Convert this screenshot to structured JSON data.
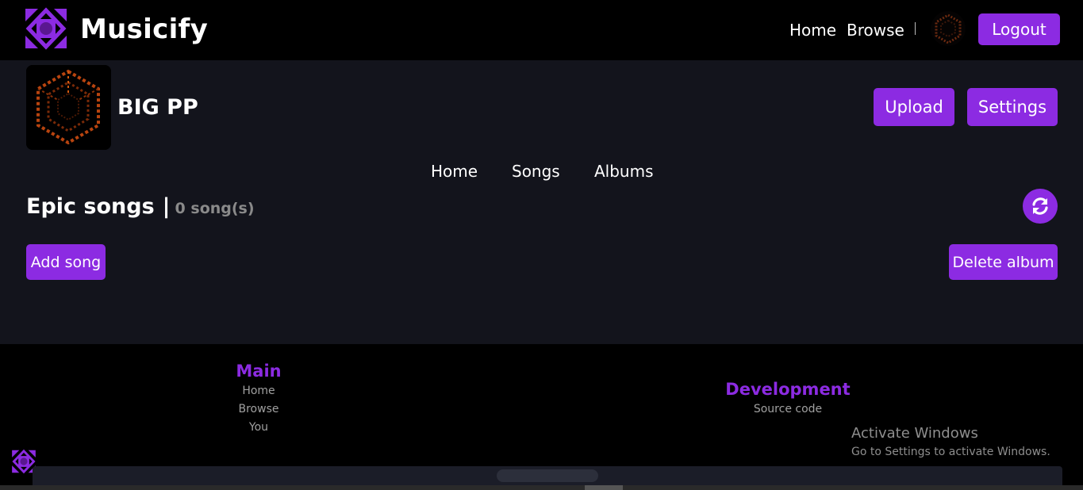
{
  "colors": {
    "accent": "#8c2be2",
    "background": "#000000",
    "panel": "#13141c",
    "muted_text": "#8a8a8a"
  },
  "header": {
    "app_name": "Musicify",
    "logo_icon": "musicify-logo-icon",
    "nav": {
      "home": "Home",
      "browse": "Browse"
    },
    "logout": "Logout"
  },
  "profile": {
    "name": "BIG PP",
    "upload": "Upload",
    "settings": "Settings"
  },
  "tabs": {
    "home": "Home",
    "songs": "Songs",
    "albums": "Albums"
  },
  "album": {
    "title": "Epic songs",
    "separator": "|",
    "count": "0 song(s)",
    "refresh_icon": "refresh-icon",
    "add_song": "Add song",
    "delete_album": "Delete album"
  },
  "footer": {
    "main": {
      "heading": "Main",
      "links": [
        "Home",
        "Browse",
        "You"
      ]
    },
    "development": {
      "heading": "Development",
      "links": [
        "Source code"
      ]
    }
  },
  "watermark": {
    "title": "Activate Windows",
    "subtitle": "Go to Settings to activate Windows."
  }
}
